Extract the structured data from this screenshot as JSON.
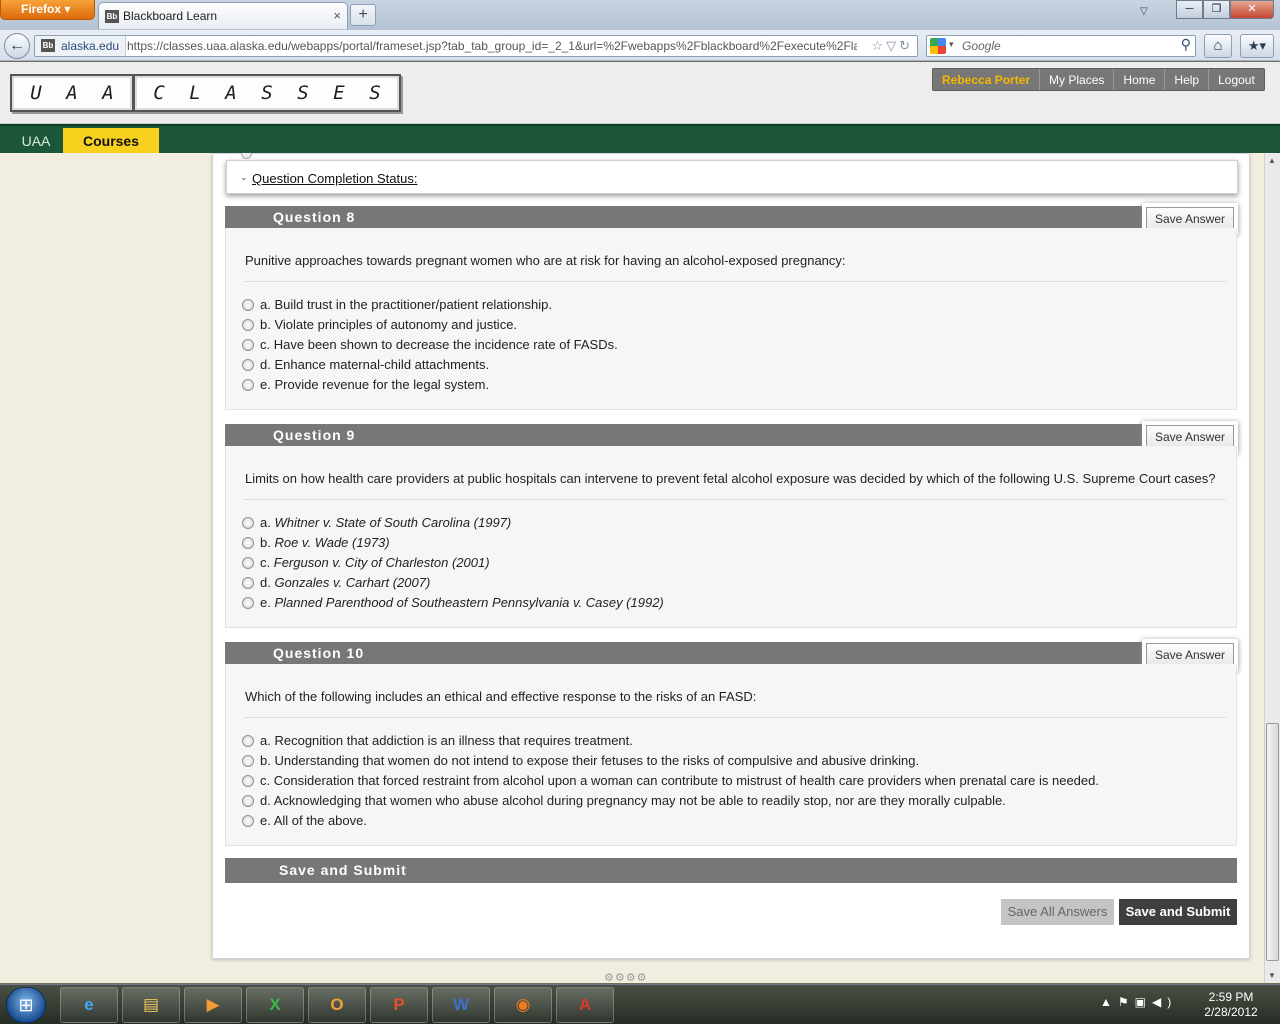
{
  "browser": {
    "app_menu": "Firefox",
    "tab_title": "Blackboard Learn",
    "site_identity": "alaska.edu",
    "url": "https://classes.uaa.alaska.edu/webapps/portal/frameset.jsp?tab_tab_group_id=_2_1&url=%2Fwebapps%2Fblackboard%2Fexecute%2Flaunc",
    "search_placeholder": "Google"
  },
  "header": {
    "logo_left": [
      "U",
      "A",
      "A"
    ],
    "logo_right": [
      "C",
      "L",
      "A",
      "S",
      "S",
      "E",
      "S"
    ],
    "user_name": "Rebecca Porter",
    "links": [
      "My Places",
      "Home",
      "Help",
      "Logout"
    ]
  },
  "tabs": {
    "uaa": "UAA",
    "courses": "Courses"
  },
  "status": {
    "label": "Question Completion Status:"
  },
  "questions": [
    {
      "title": "Question 8",
      "save_label": "Save Answer",
      "text": "Punitive approaches towards pregnant women who are at risk for having an alcohol-exposed pregnancy:",
      "answers": [
        {
          "letter": "a.",
          "text": "Build trust in the practitioner/patient relationship."
        },
        {
          "letter": "b.",
          "text": "Violate principles of autonomy and justice."
        },
        {
          "letter": "c.",
          "text": "Have been shown to decrease the incidence rate of FASDs."
        },
        {
          "letter": "d.",
          "text": "Enhance maternal-child attachments."
        },
        {
          "letter": "e.",
          "text": "Provide revenue for the legal system."
        }
      ]
    },
    {
      "title": "Question 9",
      "save_label": "Save Answer",
      "text": "Limits on how health care providers at public hospitals can intervene to prevent fetal alcohol exposure was decided by which of the following U.S. Supreme Court cases?",
      "answers": [
        {
          "letter": "a.",
          "text": "Whitner v. State of South Carolina (1997)"
        },
        {
          "letter": "b.",
          "text": "Roe v. Wade (1973)"
        },
        {
          "letter": "c.",
          "text": "Ferguson v. City of Charleston (2001)"
        },
        {
          "letter": "d.",
          "text": "Gonzales v. Carhart (2007)"
        },
        {
          "letter": "e.",
          "text": "Planned Parenthood of Southeastern Pennsylvania v. Casey (1992)"
        }
      ]
    },
    {
      "title": "Question 10",
      "save_label": "Save Answer",
      "text": "Which of the following includes an ethical and effective response to the risks of an FASD:",
      "answers": [
        {
          "letter": "a.",
          "text": "Recognition that addiction is an illness that requires treatment."
        },
        {
          "letter": "b.",
          "text": "Understanding that women do not intend to expose their fetuses to the risks of compulsive and abusive drinking."
        },
        {
          "letter": "c.",
          "text": "Consideration that forced restraint from alcohol upon a woman can contribute to mistrust of health care providers when prenatal care is needed."
        },
        {
          "letter": "d.",
          "text": "Acknowledging that women who abuse alcohol during pregnancy may not be able to readily stop, nor are they morally culpable."
        },
        {
          "letter": "e.",
          "text": "All of the above."
        }
      ]
    }
  ],
  "submit": {
    "section_title": "Save and Submit",
    "save_all_label": "Save All Answers",
    "save_submit_label": "Save and Submit"
  },
  "taskbar": {
    "apps": [
      "IE",
      "Explorer",
      "Media Player",
      "Excel",
      "Outlook",
      "PowerPoint",
      "Word",
      "Firefox",
      "Acrobat"
    ],
    "time": "2:59 PM",
    "date": "2/28/2012"
  },
  "colors": {
    "nav_green": "#1d5739",
    "courses_tab": "#f7d11e",
    "user_name": "#f5b800",
    "question_header": "#777777"
  }
}
